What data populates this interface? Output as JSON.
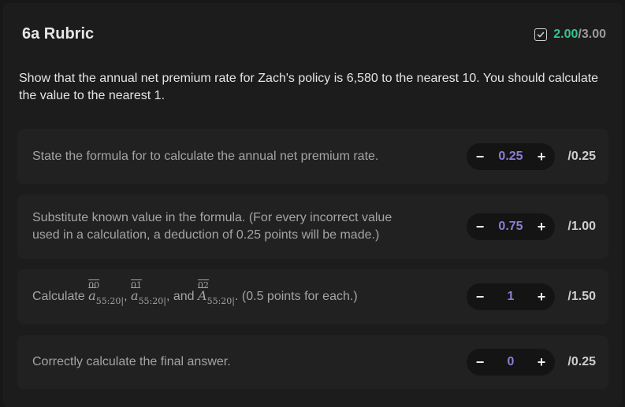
{
  "header": {
    "title": "6a Rubric",
    "score_earned": "2.00",
    "score_total": "/3.00"
  },
  "prompt": "Show that the annual net premium rate for Zach's policy is 6,580 to the nearest 10. You should calculate the value to the nearest 1.",
  "criteria": [
    {
      "description": "State the formula for to calculate the annual net premium rate.",
      "value": "0.25",
      "max": "/0.25"
    },
    {
      "description": "Substitute known value in the formula. (For every incorrect value used in a calculation, a deduction of 0.25 points will be made.)",
      "value": "0.75",
      "max": "/1.00"
    },
    {
      "description_prefix": "Calculate",
      "math_terms": [
        {
          "symbol": "a",
          "sup": "00",
          "sub": "55:20"
        },
        {
          "symbol": "a",
          "sup": "01",
          "sub": "55:20"
        },
        {
          "symbol": "A",
          "sup": "02",
          "sub": "55:20"
        }
      ],
      "and_word": "and",
      "description_suffix": ". (0.5 points for each.)",
      "value": "1",
      "max": "/1.50"
    },
    {
      "description": "Correctly calculate the final answer.",
      "value": "0",
      "max": "/0.25"
    }
  ],
  "stepper": {
    "minus_label": "−",
    "plus_label": "+"
  },
  "colors": {
    "earned": "#35c48e",
    "value": "#8f7cd6",
    "background": "#171717",
    "card": "#212121"
  },
  "icons": {
    "score_status": "checkbox-checked-icon"
  }
}
